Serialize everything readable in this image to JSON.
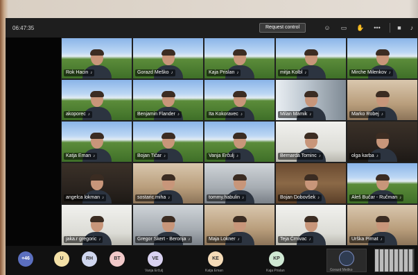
{
  "topbar": {
    "timer": "06:47:35",
    "request_control_label": "Request control",
    "icons": [
      "reactions-icon",
      "chat-icon",
      "raise-hand-icon",
      "more-icon",
      "camera-icon",
      "mic-icon"
    ]
  },
  "participants": [
    {
      "name": "Rok Hacin",
      "bg": "meadow"
    },
    {
      "name": "Gorazd Meško",
      "bg": "meadow"
    },
    {
      "name": "Kaja Prislan",
      "bg": "meadow"
    },
    {
      "name": "mitja Kolbl",
      "bg": "meadow"
    },
    {
      "name": "Mirche Milenkov",
      "bg": "meadow"
    },
    {
      "name": "akoporec",
      "bg": "meadow"
    },
    {
      "name": "Benjamin Flander",
      "bg": "meadow"
    },
    {
      "name": "Ita Kokoravec",
      "bg": "meadow"
    },
    {
      "name": "Milan Mamik",
      "bg": "window"
    },
    {
      "name": "Marko Robej",
      "bg": "warm"
    },
    {
      "name": "Katja Eman",
      "bg": "meadow"
    },
    {
      "name": "Bojan Tičar",
      "bg": "meadow"
    },
    {
      "name": "Vanja Erčulj",
      "bg": "meadow"
    },
    {
      "name": "Bernarda Tominc",
      "bg": "white"
    },
    {
      "name": "olga karba",
      "bg": "dark"
    },
    {
      "name": "angelca lokman",
      "bg": "dark"
    },
    {
      "name": "sostaric.miha",
      "bg": "warm"
    },
    {
      "name": "tommy.habulin",
      "bg": "office"
    },
    {
      "name": "Bojan Dobovšek",
      "bg": "shelf"
    },
    {
      "name": "Aleš Bučar - Ručman",
      "bg": "meadow"
    },
    {
      "name": "jaka.r gregoric",
      "bg": "white"
    },
    {
      "name": "Gregor Skert - Beronja",
      "bg": "office"
    },
    {
      "name": "Maja Lokner",
      "bg": "warm"
    },
    {
      "name": "Teja Črnivac",
      "bg": "white"
    },
    {
      "name": "Urška Pirnat",
      "bg": "warm"
    }
  ],
  "bottom": {
    "overflow_count": "+46",
    "avatars": [
      {
        "initials": "U",
        "label": "",
        "color": "#f3e0a6"
      },
      {
        "initials": "RH",
        "label": "",
        "color": "#cfd6ee"
      },
      {
        "initials": "BT",
        "label": "",
        "color": "#f1c9c9"
      },
      {
        "initials": "VE",
        "label": "Vanja Erčulj",
        "color": "#d9d2f1"
      },
      {
        "initials": "KE",
        "label": "Katja Eman",
        "color": "#f6dcb8"
      },
      {
        "initials": "KP",
        "label": "Kaja Prislan",
        "color": "#cfe8d3"
      }
    ],
    "self_label": "Gorazd Meško"
  }
}
